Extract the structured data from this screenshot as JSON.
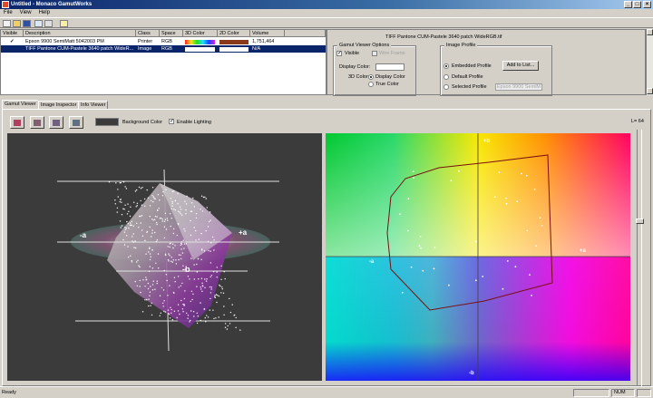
{
  "window": {
    "title": "Untitled - Monaco GamutWorks"
  },
  "menu": [
    "File",
    "View",
    "Help"
  ],
  "layers": {
    "columns": [
      "Visible",
      "Description",
      "Class",
      "Space",
      "3D Color",
      "2D Color",
      "Volume"
    ],
    "rows": [
      {
        "visible": "✓",
        "description": "Epson 9900 SemiMatt 5042003 PM",
        "class": "Printer",
        "space": "RGB",
        "volume": "1,751,464",
        "selected": false
      },
      {
        "visible": "",
        "description": "TIFF Pantone CUM-Pastele 3640 patch WideR...",
        "class": "Image",
        "space": "RGB",
        "volume": "N/A",
        "selected": true
      }
    ]
  },
  "detail": {
    "header": "TIFF Pantone CUM-Pastele 3640 patch WideRGB.tif",
    "gamut_options": {
      "title": "Gamut Viewer Options",
      "visible_label": "Visible",
      "wireframe_label": "Wire Frame",
      "display_color_label": "Display Color:",
      "color_3d_label": "3D Color:",
      "opt_display": "Display Color",
      "opt_true": "True Color"
    },
    "image_profile": {
      "title": "Image Profile",
      "embedded": "Embedded Profile",
      "default": "Default Profile",
      "selected": "Selected Profile",
      "add_button": "Add to List...",
      "profile_select": "Epson 9900 SemiM"
    }
  },
  "tabs": [
    "Gamut Viewer",
    "Image Inspector",
    "Info Viewer"
  ],
  "viewer": {
    "background_label": "Background Color",
    "lighting_label": "Enable Lighting",
    "l_value": "L= 64",
    "axis_labels": {
      "plus_b": "+b",
      "minus_b": "-b",
      "plus_a": "+a",
      "minus_a": "-a"
    }
  },
  "status": {
    "text": "Ready",
    "num": "NUM"
  },
  "colors": {
    "title_start": "#0a246a",
    "selection": "#0a246a",
    "viewer_bg": "#3b3b3b",
    "gamut_outline": "#7a1010"
  },
  "icons": [
    "new-icon",
    "open-icon",
    "save-icon",
    "export-icon",
    "print-icon",
    "help-icon"
  ]
}
